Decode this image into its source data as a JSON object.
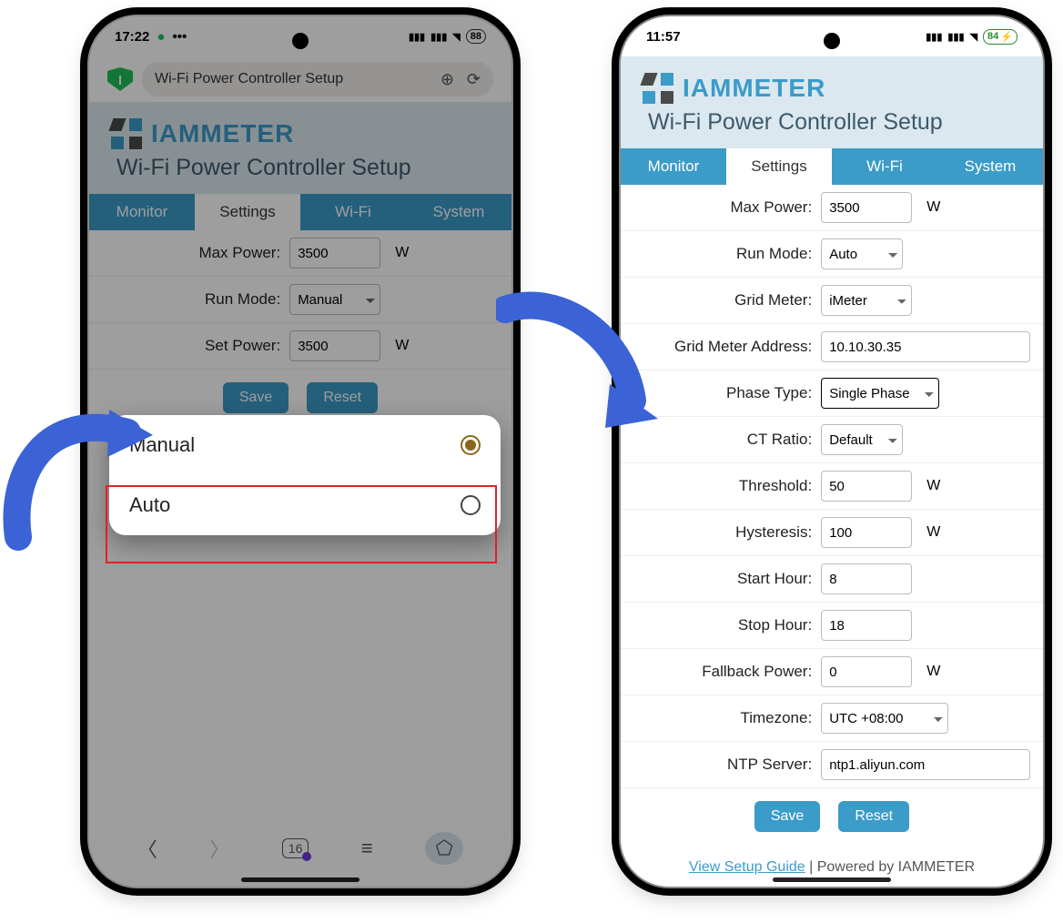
{
  "left": {
    "status": {
      "time": "17:22",
      "battery": "88"
    },
    "browser": {
      "title": "Wi-Fi Power Controller Setup"
    },
    "brand": "IAMMETER",
    "page_title": "Wi-Fi Power Controller Setup",
    "tabs": {
      "monitor": "Monitor",
      "settings": "Settings",
      "wifi": "Wi-Fi",
      "system": "System"
    },
    "form": {
      "max_power_label": "Max Power:",
      "max_power": "3500",
      "unit_w": "W",
      "run_mode_label": "Run Mode:",
      "run_mode": "Manual",
      "set_power_label": "Set Power:",
      "set_power": "3500"
    },
    "buttons": {
      "save": "Save",
      "reset": "Reset"
    },
    "sheet": {
      "opt_manual": "Manual",
      "opt_auto": "Auto"
    },
    "bottomnav": {
      "tab_count": "16"
    }
  },
  "right": {
    "status": {
      "time": "11:57",
      "battery": "84"
    },
    "brand": "IAMMETER",
    "page_title": "Wi-Fi Power Controller Setup",
    "tabs": {
      "monitor": "Monitor",
      "settings": "Settings",
      "wifi": "Wi-Fi",
      "system": "System"
    },
    "form": {
      "max_power_label": "Max Power:",
      "max_power": "3500",
      "unit_w": "W",
      "run_mode_label": "Run Mode:",
      "run_mode": "Auto",
      "grid_meter_label": "Grid Meter:",
      "grid_meter": "iMeter",
      "grid_addr_label": "Grid Meter Address:",
      "grid_addr": "10.10.30.35",
      "phase_label": "Phase Type:",
      "phase": "Single Phase",
      "ct_label": "CT Ratio:",
      "ct": "Default",
      "thresh_label": "Threshold:",
      "thresh": "50",
      "hyst_label": "Hysteresis:",
      "hyst": "100",
      "start_label": "Start Hour:",
      "start": "8",
      "stop_label": "Stop Hour:",
      "stop": "18",
      "fallback_label": "Fallback Power:",
      "fallback": "0",
      "tz_label": "Timezone:",
      "tz": "UTC +08:00",
      "ntp_label": "NTP Server:",
      "ntp": "ntp1.aliyun.com"
    },
    "buttons": {
      "save": "Save",
      "reset": "Reset"
    },
    "footer": {
      "guide": "View Setup Guide",
      "sep": " | ",
      "powered": "Powered by IAMMETER"
    }
  }
}
